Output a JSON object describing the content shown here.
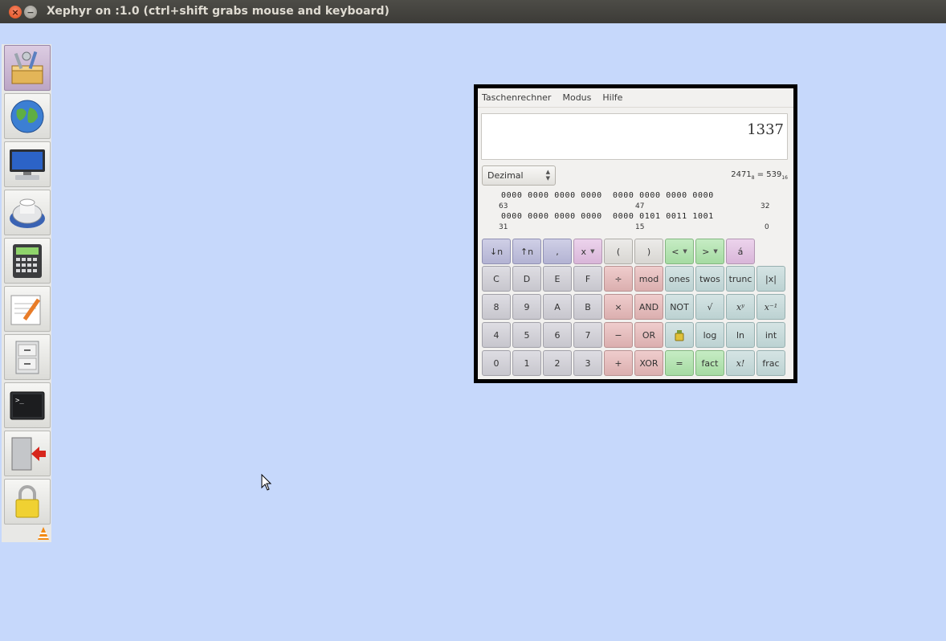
{
  "window": {
    "title": "Xephyr on :1.0 (ctrl+shift grabs mouse and keyboard)"
  },
  "launcher": {
    "items": [
      {
        "name": "system-tools-icon",
        "active": true
      },
      {
        "name": "web-browser-icon",
        "active": false
      },
      {
        "name": "monitor-icon",
        "active": false
      },
      {
        "name": "disk-icon",
        "active": false
      },
      {
        "name": "calculator-icon",
        "active": false
      },
      {
        "name": "text-editor-icon",
        "active": false
      },
      {
        "name": "file-cabinet-icon",
        "active": false
      },
      {
        "name": "terminal-icon",
        "active": false
      },
      {
        "name": "logout-icon",
        "active": false
      },
      {
        "name": "lock-icon",
        "active": false
      }
    ]
  },
  "calculator": {
    "menu": [
      "Taschenrechner",
      "Modus",
      "Hilfe"
    ],
    "display": "1337",
    "mode": "Dezimal",
    "conversion": {
      "octal": "2471",
      "octal_base": "8",
      "hex": "539",
      "hex_base": "16"
    },
    "bits": {
      "row1": "0000 0000 0000 0000  0000 0000 0000 0000",
      "row1_labels": [
        "63",
        "47",
        "32"
      ],
      "row2": "0000 0000 0000 0000  0000 0101 0011 1001",
      "row2_labels": [
        "31",
        "15",
        "0"
      ]
    },
    "keys": [
      [
        "↓n",
        "↑n",
        ",",
        "x",
        "(",
        ")",
        "<",
        ">",
        "á"
      ],
      [
        "C",
        "D",
        "E",
        "F",
        "÷",
        "mod",
        "ones",
        "twos",
        "trunc",
        "|x|"
      ],
      [
        "8",
        "9",
        "A",
        "B",
        "×",
        "AND",
        "NOT",
        "√",
        "xʸ",
        "x⁻¹"
      ],
      [
        "4",
        "5",
        "6",
        "7",
        "−",
        "OR",
        "",
        "log",
        "ln",
        "int"
      ],
      [
        "0",
        "1",
        "2",
        "3",
        "+",
        "XOR",
        "=",
        "fact",
        "x!",
        "frac"
      ]
    ]
  }
}
